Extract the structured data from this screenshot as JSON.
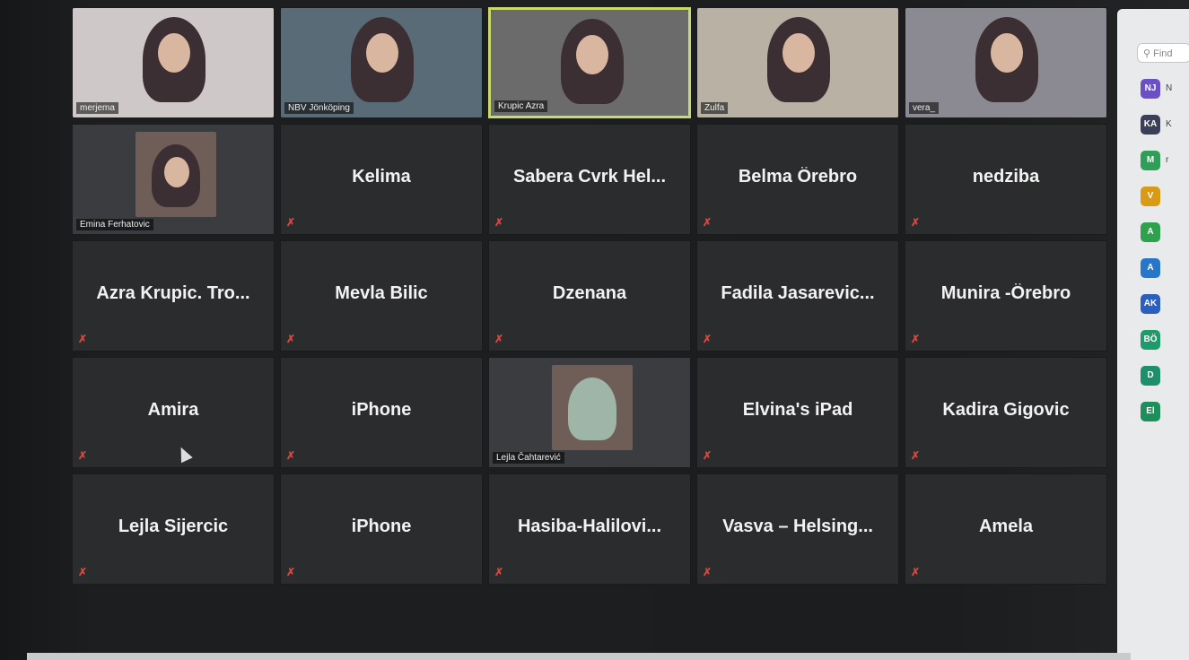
{
  "meeting": {
    "tiles": [
      {
        "name": "merjema",
        "video": true
      },
      {
        "name": "NBV Jönköping",
        "video": true
      },
      {
        "name": "Krupic Azra",
        "video": true,
        "active": true
      },
      {
        "name": "Zulfa",
        "video": true
      },
      {
        "name": "vera_",
        "video": true
      },
      {
        "name": "Emina Ferhatovic",
        "video": true
      },
      {
        "name": "Kelima"
      },
      {
        "name": "Sabera Cvrk Hel..."
      },
      {
        "name": "Belma Örebro"
      },
      {
        "name": "nedziba"
      },
      {
        "name": "Azra Krupic. Tro..."
      },
      {
        "name": "Mevla Bilic"
      },
      {
        "name": "Dzenana"
      },
      {
        "name": "Fadila Jasarevic..."
      },
      {
        "name": "Munira -Örebro"
      },
      {
        "name": "Amira"
      },
      {
        "name": "iPhone"
      },
      {
        "name": "Lejla Čahtarević",
        "video": true
      },
      {
        "name": "Elvina's iPad"
      },
      {
        "name": "Kadira Gigovic"
      },
      {
        "name": "Lejla Sijercic"
      },
      {
        "name": "iPhone"
      },
      {
        "name": "Hasiba-Halilovi..."
      },
      {
        "name": "Vasva – Helsing..."
      },
      {
        "name": "Amela"
      }
    ],
    "mute_icon": "muted-mic-icon"
  },
  "sidebar": {
    "search_placeholder": "Find",
    "participants": [
      {
        "initials": "NJ",
        "name": "N",
        "color": "#6a4fc7"
      },
      {
        "initials": "KA",
        "name": "K",
        "color": "#3c3f58"
      },
      {
        "initials": "M",
        "name": "r",
        "color": "#2f9e57"
      },
      {
        "initials": "V",
        "name": "",
        "color": "#d99a16"
      },
      {
        "initials": "A",
        "name": "",
        "color": "#2ea14c"
      },
      {
        "initials": "A",
        "name": "",
        "color": "#2677c9"
      },
      {
        "initials": "AK",
        "name": "",
        "color": "#2a5fbf"
      },
      {
        "initials": "BÖ",
        "name": "",
        "color": "#1f9b6b"
      },
      {
        "initials": "D",
        "name": "",
        "color": "#1d8f6a"
      },
      {
        "initials": "El",
        "name": "",
        "color": "#1e8f5a"
      }
    ]
  }
}
